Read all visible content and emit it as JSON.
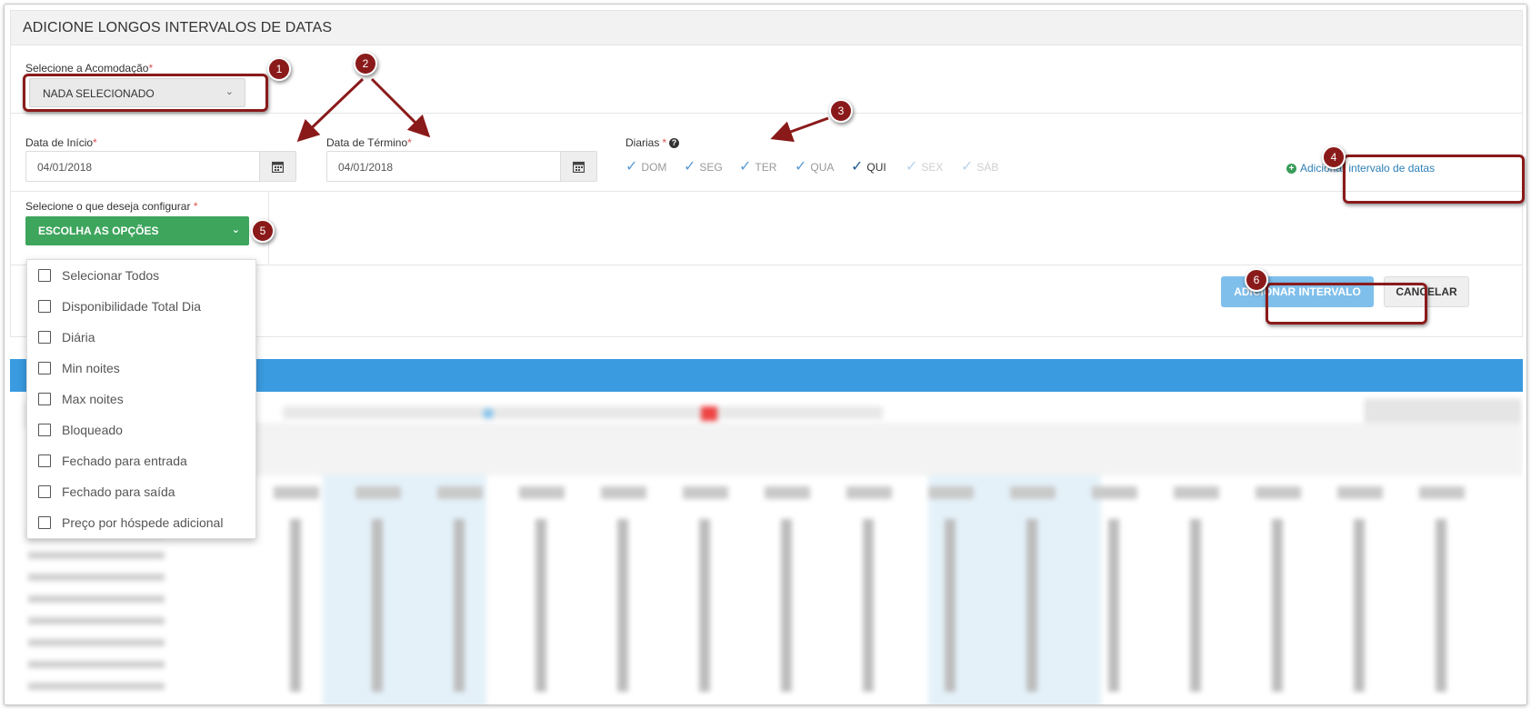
{
  "panel": {
    "title": "ADICIONE LONGOS INTERVALOS DE DATAS"
  },
  "accommodation": {
    "label": "Selecione a Acomodação",
    "required_mark": "*",
    "value": "NADA SELECIONADO"
  },
  "start_date": {
    "label": "Data de Início",
    "required_mark": "*",
    "value": "04/01/2018"
  },
  "end_date": {
    "label": "Data de Término",
    "required_mark": "*",
    "value": "04/01/2018"
  },
  "days": {
    "label": "Diarias",
    "required_mark": "*",
    "help_icon": "question-circle-icon",
    "items": [
      {
        "label": "DOM",
        "state": "checked"
      },
      {
        "label": "SEG",
        "state": "checked"
      },
      {
        "label": "TER",
        "state": "checked"
      },
      {
        "label": "QUA",
        "state": "checked"
      },
      {
        "label": "QUI",
        "state": "active"
      },
      {
        "label": "SEX",
        "state": "faded"
      },
      {
        "label": "SÁB",
        "state": "faded"
      }
    ]
  },
  "add_range_link": {
    "label": "Adicionar intervalo de datas"
  },
  "configure": {
    "label": "Selecione o que deseja configurar",
    "required_mark": "*",
    "button": "ESCOLHA AS OPÇÕES",
    "options": [
      "Selecionar Todos",
      "Disponibilidade Total Dia",
      "Diária",
      "Min noites",
      "Max noites",
      "Bloqueado",
      "Fechado para entrada",
      "Fechado para saída",
      "Preço por hóspede adicional"
    ]
  },
  "actions": {
    "add": "ADICIONAR INTERVALO",
    "cancel": "CANCELAR"
  },
  "callouts": [
    "1",
    "2",
    "3",
    "4",
    "5",
    "6"
  ],
  "colors": {
    "accent_blue": "#3a9be0",
    "green": "#3ea55d",
    "callout": "#8a1a1a",
    "link": "#2e7fb8"
  }
}
